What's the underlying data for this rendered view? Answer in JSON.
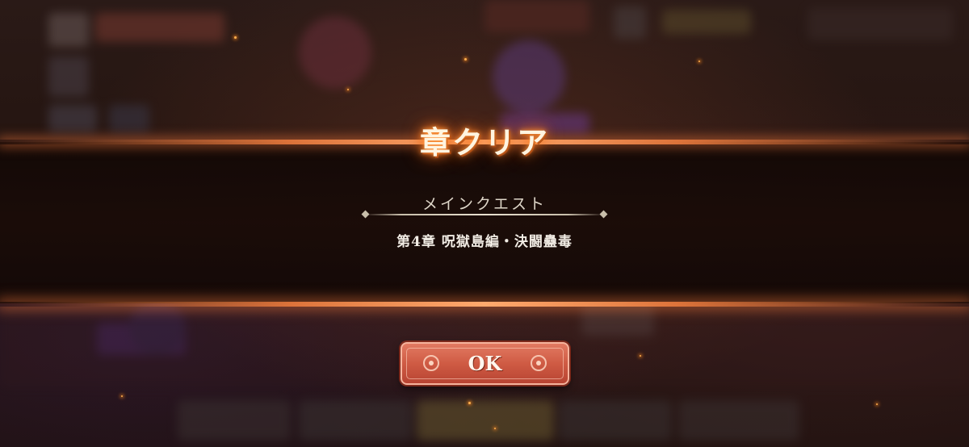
{
  "result_popup": {
    "title": "章クリア",
    "quest_type": "メインクエスト",
    "chapter_name": "第4章 呪獄島編・決闘蠱毒",
    "ok_label": "OK"
  },
  "colors": {
    "banner_glow": "#f07a3c",
    "title_glow": "#ff8a30",
    "ok_button": "#d4604a",
    "banner_fill": "#1a0c08"
  }
}
